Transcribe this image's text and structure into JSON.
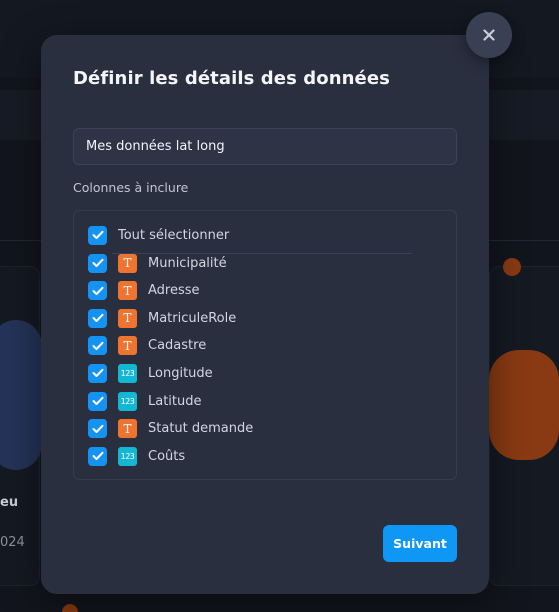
{
  "background": {
    "snippet_left_1": "eu",
    "snippet_left_2": "024"
  },
  "modal": {
    "title": "Définir les détails des données",
    "close_icon": "close-icon",
    "name_input": {
      "value": "Mes données lat long",
      "placeholder": ""
    },
    "columns_label": "Colonnes à inclure",
    "select_all": {
      "label": "Tout sélectionner",
      "checked": true
    },
    "columns": [
      {
        "label": "Municipalité",
        "type": "text",
        "type_glyph": "T",
        "checked": true
      },
      {
        "label": "Adresse",
        "type": "text",
        "type_glyph": "T",
        "checked": true
      },
      {
        "label": "MatriculeRole",
        "type": "text",
        "type_glyph": "T",
        "checked": true
      },
      {
        "label": "Cadastre",
        "type": "text",
        "type_glyph": "T",
        "checked": true
      },
      {
        "label": "Longitude",
        "type": "number",
        "type_glyph": "123",
        "checked": true
      },
      {
        "label": "Latitude",
        "type": "number",
        "type_glyph": "123",
        "checked": true
      },
      {
        "label": "Statut demande",
        "type": "text",
        "type_glyph": "T",
        "checked": true
      },
      {
        "label": "Coûts",
        "type": "number",
        "type_glyph": "123",
        "checked": true
      }
    ],
    "next_button": "Suivant"
  },
  "colors": {
    "accent": "#1593f3",
    "text_type": "#ee7430",
    "number_type": "#13b7d3",
    "modal_bg": "#2a2f40"
  }
}
